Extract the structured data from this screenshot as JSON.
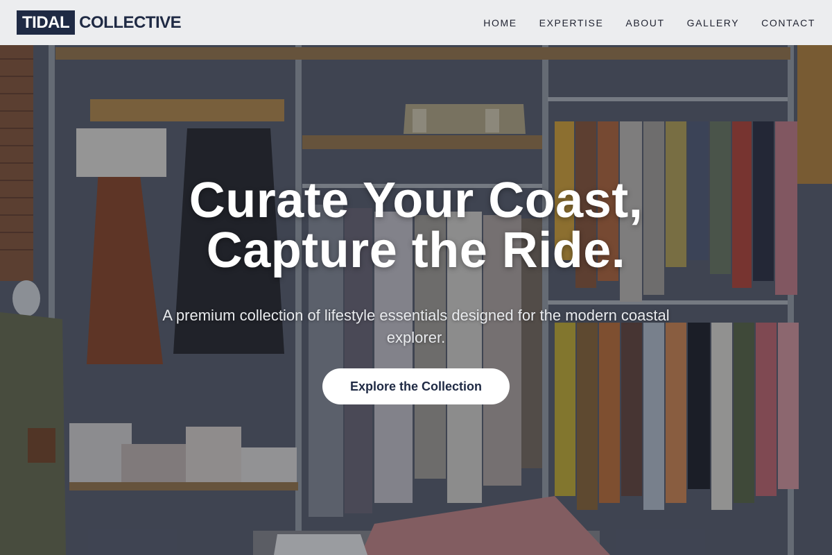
{
  "header": {
    "logo_box": "TIDAL",
    "logo_text": "COLLECTIVE",
    "nav": [
      {
        "label": "HOME"
      },
      {
        "label": "EXPERTISE"
      },
      {
        "label": "ABOUT"
      },
      {
        "label": "GALLERY"
      },
      {
        "label": "CONTACT"
      }
    ]
  },
  "hero": {
    "title_line1": "Curate Your Coast,",
    "title_line2": "Capture the Ride.",
    "subtitle": "A premium collection of lifestyle essentials designed for the modern coastal explorer.",
    "cta_label": "Explore the Collection",
    "background_image": "clothing-store-interior"
  },
  "colors": {
    "brand_navy": "#1f2a44",
    "header_bg": "#ecedef",
    "cta_bg": "#ffffff"
  }
}
